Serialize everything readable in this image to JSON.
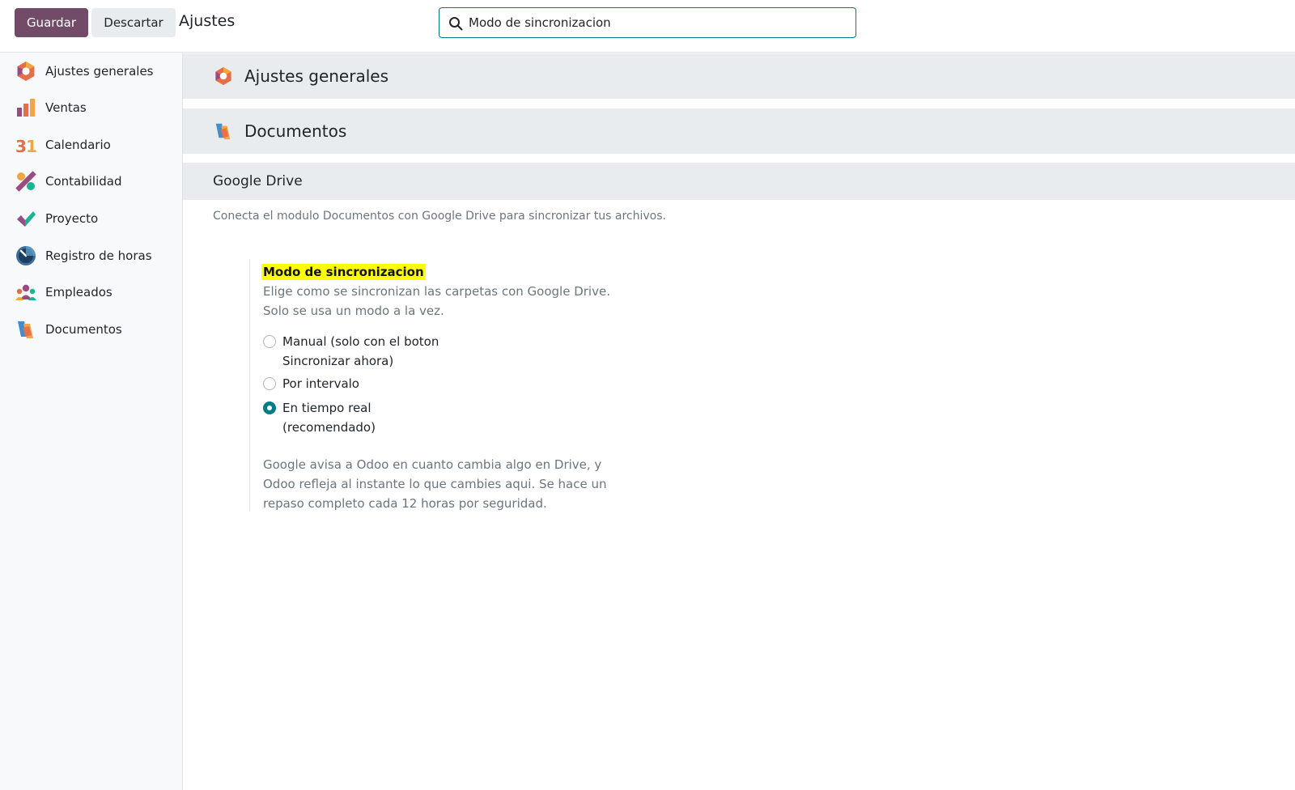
{
  "toolbar": {
    "save_label": "Guardar",
    "discard_label": "Descartar",
    "breadcrumb": "Ajustes"
  },
  "search": {
    "value": "Modo de sincronizacion"
  },
  "sidebar": {
    "items": [
      {
        "label": "Ajustes generales",
        "icon": "settings-hexagon-icon"
      },
      {
        "label": "Ventas",
        "icon": "sales-chart-icon"
      },
      {
        "label": "Calendario",
        "icon": "calendar-icon"
      },
      {
        "label": "Contabilidad",
        "icon": "accounting-icon"
      },
      {
        "label": "Proyecto",
        "icon": "project-check-icon"
      },
      {
        "label": "Registro de horas",
        "icon": "timesheet-clock-icon"
      },
      {
        "label": "Empleados",
        "icon": "employees-icon"
      },
      {
        "label": "Documentos",
        "icon": "documents-icon"
      }
    ]
  },
  "main": {
    "apps": [
      {
        "title": "Ajustes generales",
        "icon": "settings-hexagon-icon"
      },
      {
        "title": "Documentos",
        "icon": "documents-icon"
      }
    ],
    "section": {
      "title": "Google Drive",
      "description": "Conecta el modulo Documentos con Google Drive para sincronizar tus archivos."
    },
    "setting": {
      "title": "Modo de sincronizacion",
      "help_line1": "Elige como se sincronizan las carpetas con Google Drive.",
      "help_line2": "Solo se usa un modo a la vez.",
      "options": [
        {
          "label_line1": "Manual (solo con el boton",
          "label_line2": "Sincronizar ahora)",
          "selected": false
        },
        {
          "label_line1": "Por intervalo",
          "label_line2": "",
          "selected": false
        },
        {
          "label_line1": "En tiempo real",
          "label_line2": "(recomendado)",
          "selected": true
        }
      ],
      "note_line1": "Google avisa a Odoo en cuanto cambia algo en Drive, y",
      "note_line2": "Odoo refleja al instante lo que cambies aqui. Se hace un",
      "note_line3": "repaso completo cada 12 horas por seguridad."
    }
  },
  "colors": {
    "brand": "#714B67",
    "accent": "#017e84",
    "highlight": "#ffff00"
  }
}
